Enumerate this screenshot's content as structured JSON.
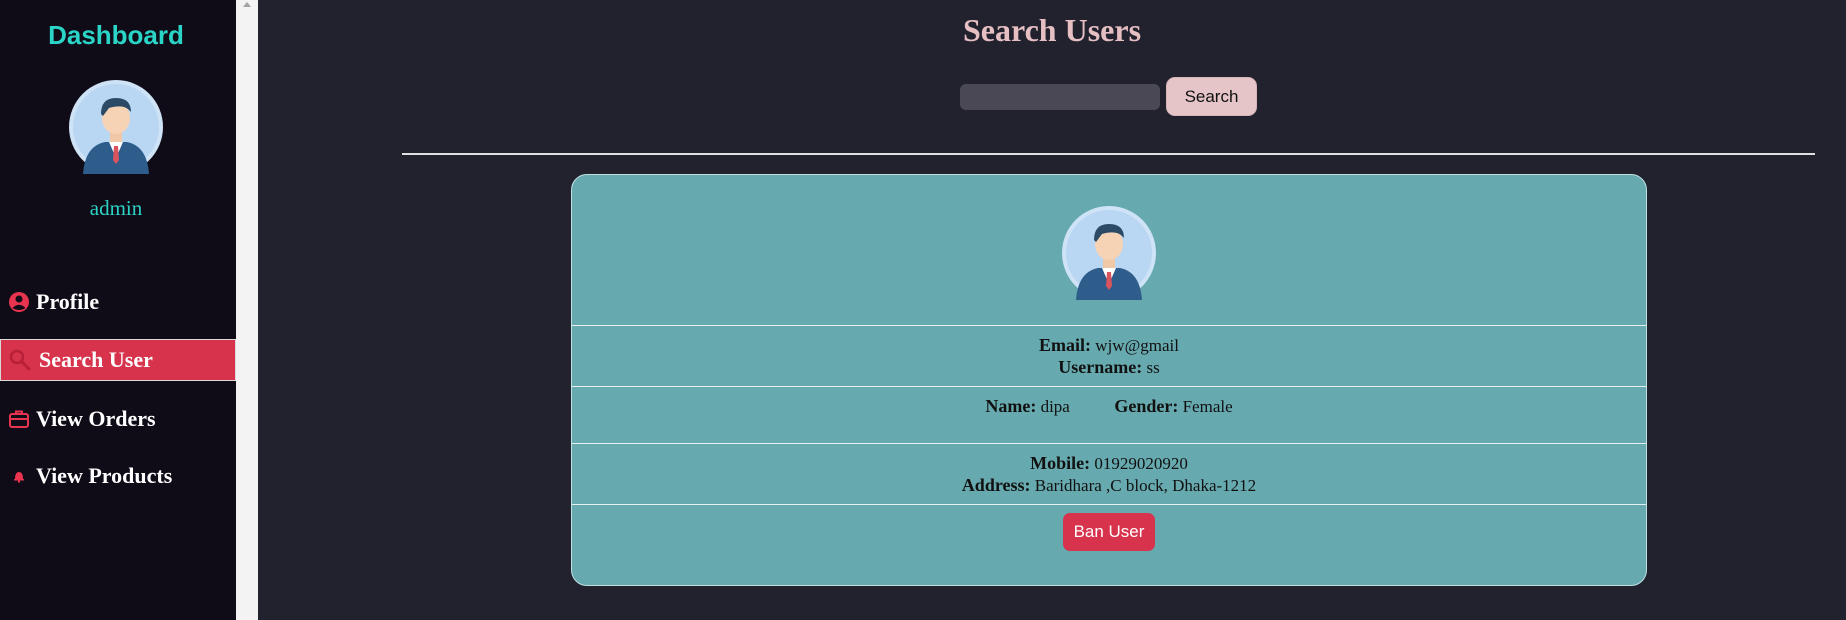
{
  "sidebar": {
    "title": "Dashboard",
    "username": "admin",
    "items": [
      {
        "label": "Profile",
        "icon": "user-circle-icon"
      },
      {
        "label": "Search User",
        "icon": "search-icon"
      },
      {
        "label": "View Orders",
        "icon": "briefcase-icon"
      },
      {
        "label": "View Products",
        "icon": "bell-icon"
      }
    ]
  },
  "main": {
    "title": "Search Users",
    "search": {
      "value": "",
      "placeholder": "",
      "button_label": "Search"
    }
  },
  "user_card": {
    "email_label": "Email:",
    "email": "wjw@gmail",
    "username_label": "Username:",
    "username": "ss",
    "name_label": "Name:",
    "name": "dipa",
    "gender_label": "Gender:",
    "gender": "Female",
    "mobile_label": "Mobile:",
    "mobile": "01929020920",
    "address_label": "Address:",
    "address": "Baridhara ,C block, Dhaka-1212",
    "ban_label": "Ban User"
  },
  "colors": {
    "sidebar_bg": "#0f0c18",
    "main_bg": "#22222f",
    "accent_teal": "#2ad4c6",
    "accent_red": "#d8334c",
    "card_bg": "#66a9ae",
    "title_pink": "#e6bfc3"
  }
}
